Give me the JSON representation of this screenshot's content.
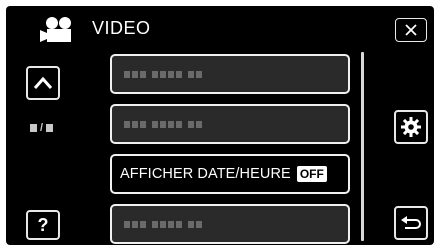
{
  "header": {
    "title": "VIDEO",
    "mode_icon": "video-camera-icon"
  },
  "nav": {
    "up_icon": "chevron-up-icon",
    "help_label": "?",
    "close_icon": "close-icon",
    "settings_icon": "gear-icon",
    "back_icon": "return-arrow-icon",
    "page_separator": "/"
  },
  "menu": {
    "items": [
      {
        "label": "",
        "blurred": true
      },
      {
        "label": "",
        "blurred": true
      },
      {
        "label": "AFFICHER DATE/HEURE",
        "badge": "OFF",
        "active": true
      },
      {
        "label": "",
        "blurred": true
      }
    ]
  }
}
